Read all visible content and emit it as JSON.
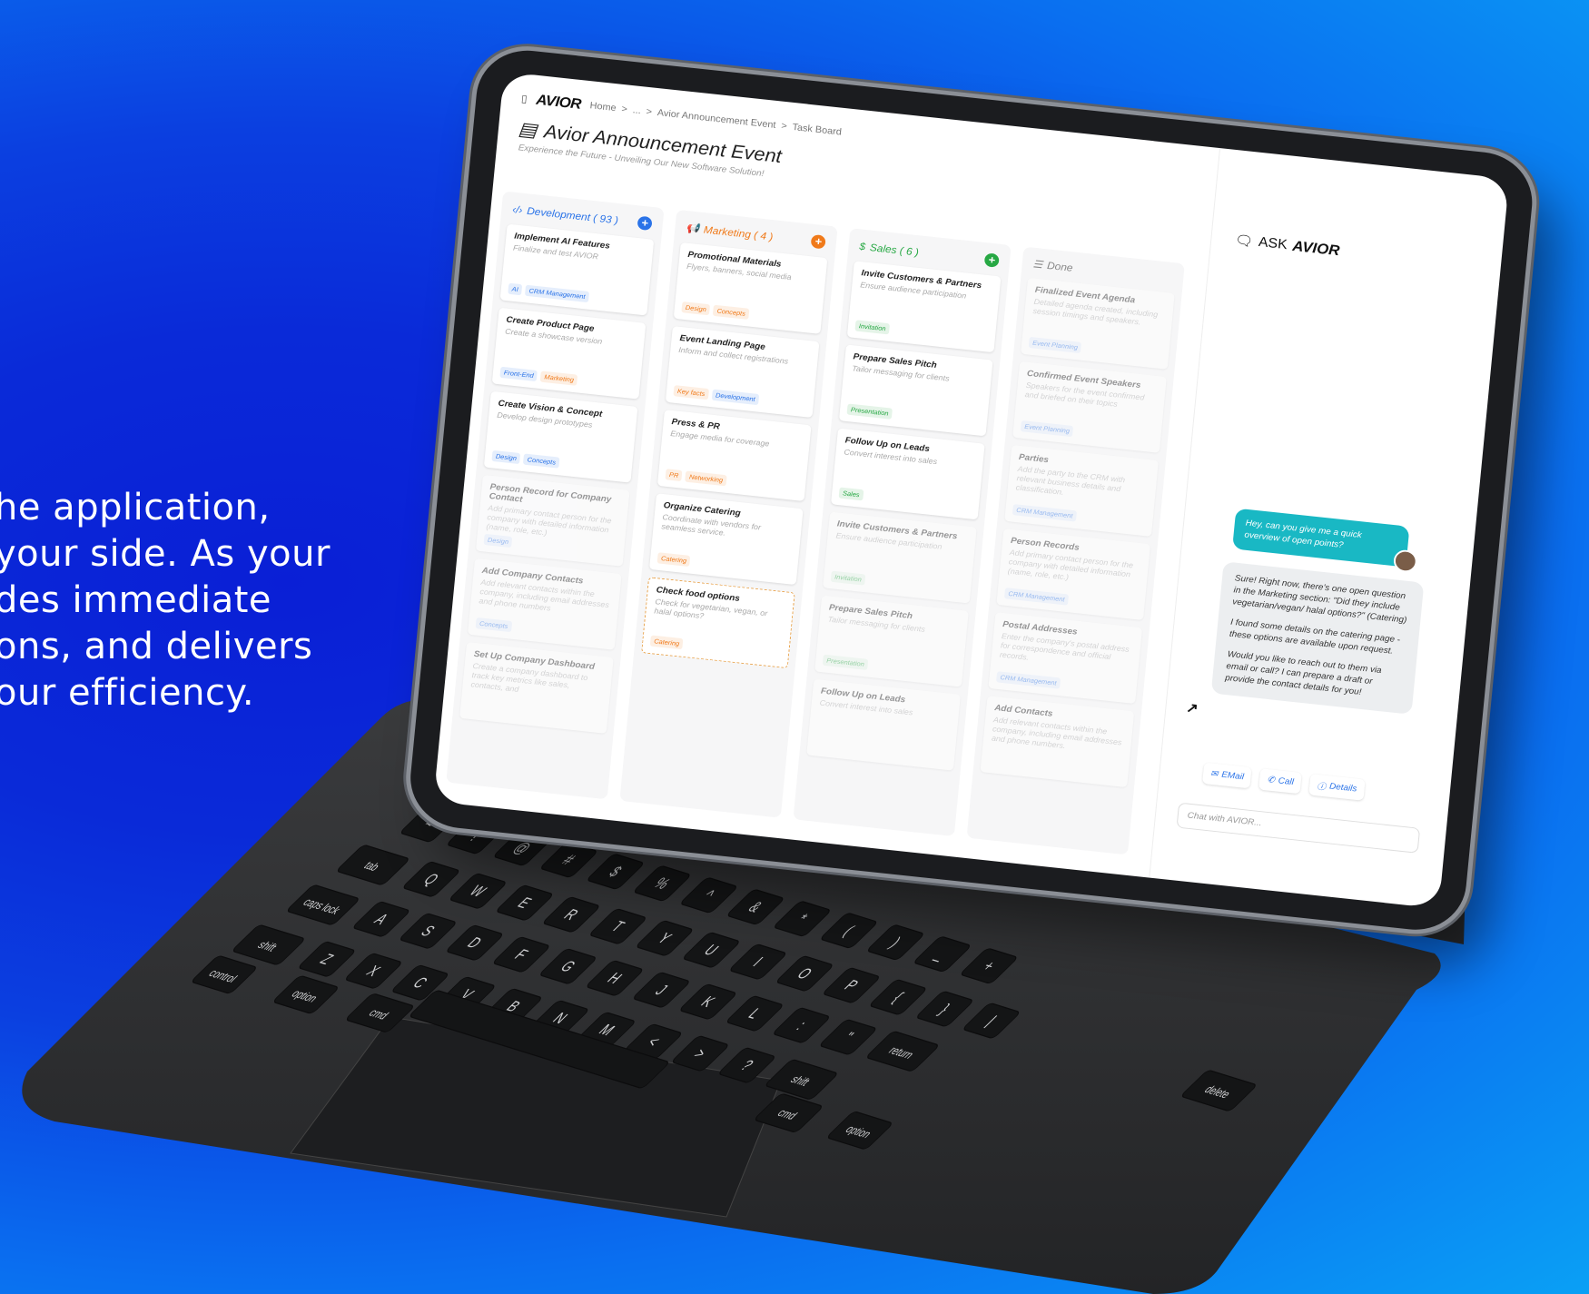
{
  "tagline": {
    "line1": "he application,",
    "line2": "your side. As your",
    "line3": "des immediate",
    "line4": "ons, and delivers",
    "line5": "our efficiency."
  },
  "app": {
    "logo": "AVIOR",
    "breadcrumbs": [
      "Home",
      ">",
      "...",
      ">",
      "Avior Announcement Event",
      ">",
      "Task Board"
    ],
    "title": "Avior Announcement Event",
    "subtitle": "Experience the Future - Unveiling Our New Software Solution!"
  },
  "board": {
    "columns": [
      {
        "name": "Development ( 93 )",
        "icon": "code-icon",
        "color": "#2a73e8",
        "cards": [
          {
            "title": "Implement AI Features",
            "sub": "Finalize and test AVIOR",
            "tags": [
              "AI",
              "CRM Management"
            ]
          },
          {
            "title": "Create Product Page",
            "sub": "Create a showcase version",
            "tags": [
              "Front-End",
              "Marketing"
            ]
          },
          {
            "title": "Create Vision & Concept",
            "sub": "Develop design prototypes",
            "tags": [
              "Design",
              "Concepts"
            ]
          },
          {
            "title": "Person Record for Company Contact",
            "sub": "Add primary contact person for the company with detailed information (name, role, etc.)",
            "tags": [
              "Design"
            ]
          },
          {
            "title": "Add Company Contacts",
            "sub": "Add relevant contacts within the company, including email addresses and phone numbers",
            "tags": [
              "Concepts"
            ]
          },
          {
            "title": "Set Up Company Dashboard",
            "sub": "Create a company dashboard to track key metrics like sales, contacts, and",
            "tags": []
          }
        ]
      },
      {
        "name": "Marketing ( 4 )",
        "icon": "megaphone-icon",
        "color": "#f07a1a",
        "cards": [
          {
            "title": "Promotional Materials",
            "sub": "Flyers, banners, social media",
            "tags": [
              "Design",
              "Concepts"
            ]
          },
          {
            "title": "Event Landing Page",
            "sub": "Inform and collect registrations",
            "tags": [
              "Key facts",
              "Development"
            ]
          },
          {
            "title": "Press & PR",
            "sub": "Engage media for coverage",
            "tags": [
              "PR",
              "Networking"
            ]
          },
          {
            "title": "Organize Catering",
            "sub": "Coordinate with vendors for seamless service.",
            "tags": [
              "Catering"
            ]
          },
          {
            "title": "Check food options",
            "sub": "Check for vegetarian, vegan, or halal options?",
            "tags": [
              "Catering"
            ]
          }
        ]
      },
      {
        "name": "Sales ( 6 )",
        "icon": "dollar-icon",
        "color": "#27a844",
        "cards": [
          {
            "title": "Invite Customers & Partners",
            "sub": "Ensure audience participation",
            "tags": [
              "Invitation"
            ]
          },
          {
            "title": "Prepare Sales Pitch",
            "sub": "Tailor messaging for clients",
            "tags": [
              "Presentation"
            ]
          },
          {
            "title": "Follow Up on Leads",
            "sub": "Convert interest into sales",
            "tags": [
              "Sales"
            ]
          },
          {
            "title": "Invite Customers & Partners",
            "sub": "Ensure audience participation",
            "tags": [
              "Invitation"
            ]
          },
          {
            "title": "Prepare Sales Pitch",
            "sub": "Tailor messaging for clients",
            "tags": [
              "Presentation"
            ]
          },
          {
            "title": "Follow Up on Leads",
            "sub": "Convert interest into sales",
            "tags": []
          }
        ]
      },
      {
        "name": "Done",
        "icon": "checklist-icon",
        "color": "#888888",
        "cards": [
          {
            "title": "Finalized Event Agenda",
            "sub": "Detailed agenda created, including session timings and speakers.",
            "tags": [
              "Event Planning"
            ]
          },
          {
            "title": "Confirmed Event Speakers",
            "sub": "Speakers for the event confirmed and briefed on their topics",
            "tags": [
              "Event Planning"
            ]
          },
          {
            "title": "Parties",
            "sub": "Add the party to the CRM with relevant business details and classification.",
            "tags": [
              "CRM Management"
            ]
          },
          {
            "title": "Person Records",
            "sub": "Add primary contact person for the company with detailed information (name, role, etc.)",
            "tags": [
              "CRM Management"
            ]
          },
          {
            "title": "Postal Addresses",
            "sub": "Enter the company's postal address for correspondence and official records.",
            "tags": [
              "CRM Management"
            ]
          },
          {
            "title": "Add Contacts",
            "sub": "Add relevant contacts within the company, including email addresses and phone numbers.",
            "tags": []
          }
        ]
      }
    ]
  },
  "chat": {
    "header_prefix": "ASK",
    "header_brand": "AVIOR",
    "user_message": "Hey, can you give me a quick overview of open points?",
    "bot_p1": "Sure! Right now, there's one open question in the Marketing section: \"Did they include vegetarian/vegan/ halal options?\" (Catering)",
    "bot_p2": "I found some details on the catering page - these options are available upon request.",
    "bot_p3": "Would you like to reach out to them via email or call? I can prepare a draft or provide the contact details for you!",
    "actions": [
      "EMail",
      "Call",
      "Details"
    ],
    "input_placeholder": "Chat with AVIOR..."
  },
  "keyboard": {
    "row_numbers": [
      "~",
      "!",
      "@",
      "#",
      "$",
      "%",
      "^",
      "&",
      "*",
      "(",
      ")",
      "_",
      "+"
    ],
    "row_q": [
      "tab",
      "Q",
      "W",
      "E",
      "R",
      "T",
      "Y",
      "U",
      "I",
      "O",
      "P",
      "{",
      "}",
      "|"
    ],
    "row_a": [
      "caps lock",
      "A",
      "S",
      "D",
      "F",
      "G",
      "H",
      "J",
      "K",
      "L",
      ":",
      "\"",
      "return"
    ],
    "row_z": [
      "shift",
      "Z",
      "X",
      "C",
      "V",
      "B",
      "N",
      "M",
      "<",
      ">",
      "?",
      "shift"
    ],
    "row_mod": [
      "control",
      "option",
      "cmd",
      "cmd",
      "option"
    ],
    "delete": "delete"
  },
  "colors": {
    "accent_blue": "#2a73e8",
    "marketing_orange": "#f07a1a",
    "sales_green": "#27a844",
    "chat_teal": "#19b8c4"
  }
}
